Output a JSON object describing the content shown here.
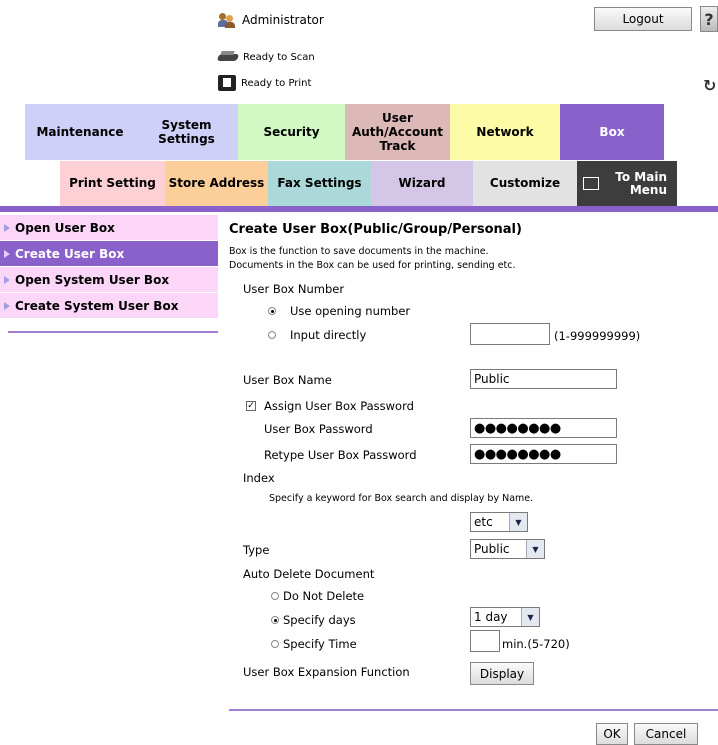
{
  "header": {
    "user": "Administrator",
    "logout_label": "Logout",
    "help_label": "?",
    "scan_status": "Ready to Scan",
    "print_status": "Ready to Print",
    "refresh_label": "↻"
  },
  "main_tabs": [
    {
      "label": "Maintenance",
      "color": "#cfd0f7"
    },
    {
      "label": "System Settings",
      "color": "#cfd0f7"
    },
    {
      "label": "Security",
      "color": "#d2f8c4"
    },
    {
      "label": "User Auth/Account Track",
      "color": "#dcb8b6"
    },
    {
      "label": "Network",
      "color": "#fdfca6"
    },
    {
      "label": "Box",
      "color": "#8a60ca"
    }
  ],
  "sub_tabs": [
    {
      "label": "Print Setting",
      "color": "#fdd0d6"
    },
    {
      "label": "Store Address",
      "color": "#fccf9a"
    },
    {
      "label": "Fax Settings",
      "color": "#abd8d9"
    },
    {
      "label": "Wizard",
      "color": "#d4c6e7"
    },
    {
      "label": "Customize",
      "color": "#e2e2e2"
    },
    {
      "label": "To Main Menu",
      "color": "#3d3d3d"
    }
  ],
  "sidebar": {
    "items": [
      {
        "label": "Open User Box"
      },
      {
        "label": "Create User Box"
      },
      {
        "label": "Open System User Box"
      },
      {
        "label": "Create System User Box"
      }
    ]
  },
  "form": {
    "title": "Create User Box(Public/Group/Personal)",
    "desc1": "Box is the function to save documents in the machine.",
    "desc2": "Documents in the Box can be used for printing, sending etc.",
    "box_number_label": "User Box Number",
    "use_opening_number": "Use opening number",
    "input_directly": "Input directly",
    "input_directly_value": "",
    "input_directly_range": "(1-999999999)",
    "box_name_label": "User Box Name",
    "box_name_value": "Public",
    "assign_password": "Assign User Box Password",
    "password_label": "User Box Password",
    "password_value": "●●●●●●●●",
    "retype_label": "Retype User Box Password",
    "retype_value": "●●●●●●●●",
    "index_label": "Index",
    "index_hint": "Specify a keyword for Box search and display by Name.",
    "index_value": "etc",
    "type_label": "Type",
    "type_value": "Public",
    "auto_delete_label": "Auto Delete Document",
    "do_not_delete": "Do Not Delete",
    "specify_days": "Specify days",
    "days_value": "1 day",
    "specify_time": "Specify Time",
    "time_value": "",
    "time_range": "min.(5-720)",
    "expansion_label": "User Box Expansion Function",
    "display_button": "Display",
    "ok_button": "OK",
    "cancel_button": "Cancel"
  }
}
